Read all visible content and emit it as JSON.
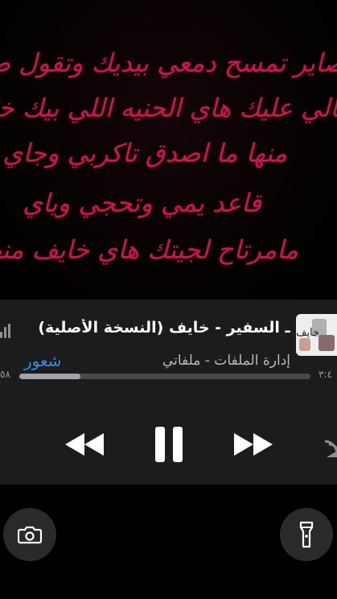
{
  "lyrics": [
    "صاير تمسح دمعي بيديك وتقول ضل",
    "بالي عليك هاي الحنيه اللي بيك خايف",
    "منها ما اصدق تاكربي وجاي !",
    "قاعد يمي وتحجي وياي",
    "مامرتاح لجيتك هاي خايف منها"
  ],
  "player": {
    "album_art_text": "خايف",
    "title": "ـ السفير - خايف (النسخة الأصلية)",
    "subtitle": "إدارة الملفات - ملفاتي",
    "source_label": "شعور",
    "elapsed": "٥٨",
    "remaining": "٣:٤",
    "progress": 0.21,
    "icons": [
      "equalizer-icon",
      "rewind-icon",
      "pause-icon",
      "fast-forward-icon",
      "airplay-icon"
    ]
  },
  "lockscreen": {
    "left_button_icon": "camera-icon",
    "right_button_icon": "flashlight-icon"
  },
  "colors": {
    "lyrics": "#c21a4a",
    "player_bg": "#1c1c1e",
    "source_accent": "#3a8be0"
  }
}
